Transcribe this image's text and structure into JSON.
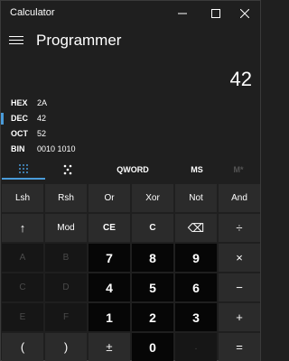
{
  "window": {
    "title": "Calculator"
  },
  "header": {
    "mode": "Programmer"
  },
  "display": {
    "value": "42"
  },
  "radix": [
    {
      "key": "HEX",
      "value": "2A",
      "selected": false
    },
    {
      "key": "DEC",
      "value": "42",
      "selected": true
    },
    {
      "key": "OCT",
      "value": "52",
      "selected": false
    },
    {
      "key": "BIN",
      "value": "0010 1010",
      "selected": false
    }
  ],
  "mode_bar": {
    "word_size": "QWORD",
    "memory_store": "MS",
    "memory_recall": "M*"
  },
  "keypad": {
    "rows": [
      [
        "Lsh",
        "Rsh",
        "Or",
        "Xor",
        "Not",
        "And"
      ],
      [
        "↑",
        "Mod",
        "CE",
        "C",
        "⌫",
        "÷"
      ],
      [
        "A",
        "B",
        "7",
        "8",
        "9",
        "×"
      ],
      [
        "C",
        "D",
        "4",
        "5",
        "6",
        "−"
      ],
      [
        "E",
        "F",
        "1",
        "2",
        "3",
        "+"
      ],
      [
        "(",
        ")",
        "±",
        "0",
        ".",
        "="
      ]
    ]
  },
  "colors": {
    "accent": "#4a9bd9",
    "background": "#1f1f1f"
  },
  "icons": {
    "keypad_tab": "dot-grid-icon",
    "bit_toggle_tab": "bit-toggle-icon"
  }
}
